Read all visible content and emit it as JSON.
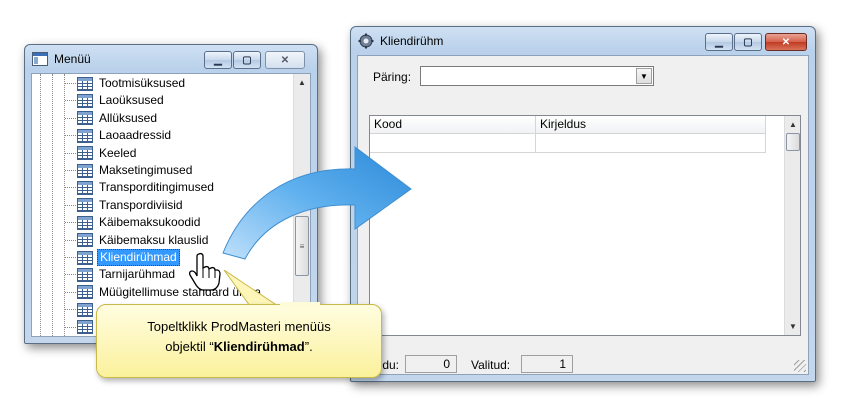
{
  "menu_window": {
    "title": "Menüü",
    "buttons": {
      "minimize": "▁",
      "maximize": "▢",
      "close": "✕"
    },
    "tree_items": [
      {
        "label": "Tootmisüksused",
        "selected": false
      },
      {
        "label": "Laoüksused",
        "selected": false
      },
      {
        "label": "Allüksused",
        "selected": false
      },
      {
        "label": "Laoaadressid",
        "selected": false
      },
      {
        "label": "Keeled",
        "selected": false
      },
      {
        "label": "Maksetingimused",
        "selected": false
      },
      {
        "label": "Transporditingimused",
        "selected": false
      },
      {
        "label": "Transpordiviisid",
        "selected": false
      },
      {
        "label": "Käibemaksukoodid",
        "selected": false
      },
      {
        "label": "Käibemaksu klauslid",
        "selected": false
      },
      {
        "label": "Kliendirühmad",
        "selected": true
      },
      {
        "label": "Tarnijarühmad",
        "selected": false
      },
      {
        "label": "Müügitellimuse standard ülesa",
        "selected": false
      },
      {
        "label": "",
        "selected": false
      },
      {
        "label": "",
        "selected": false
      }
    ]
  },
  "kr_window": {
    "title": "Kliendirühm",
    "buttons": {
      "minimize": "▁",
      "maximize": "▢",
      "close": "✕"
    },
    "query_label": "Päring:",
    "query_value": "",
    "columns": [
      "Kood",
      "Kirjeldus"
    ],
    "rows": [
      [
        "",
        ""
      ]
    ],
    "status": {
      "rows_label": "Ridu:",
      "rows_value": "0",
      "selected_label": "Valitud:",
      "selected_value": "1"
    }
  },
  "callout": {
    "line1": "Topeltklikk ProdMasteri menüüs",
    "line2_prefix": "objektil  “",
    "line2_bold": "Kliendirühmad",
    "line2_suffix": "”."
  },
  "icons": {
    "arrow": "blue-curved-arrow-icon",
    "cursor": "hand-cursor-icon"
  },
  "colors": {
    "selection": "#3399ff",
    "arrow": "#3b9be0",
    "callout": "#fbf19c"
  }
}
